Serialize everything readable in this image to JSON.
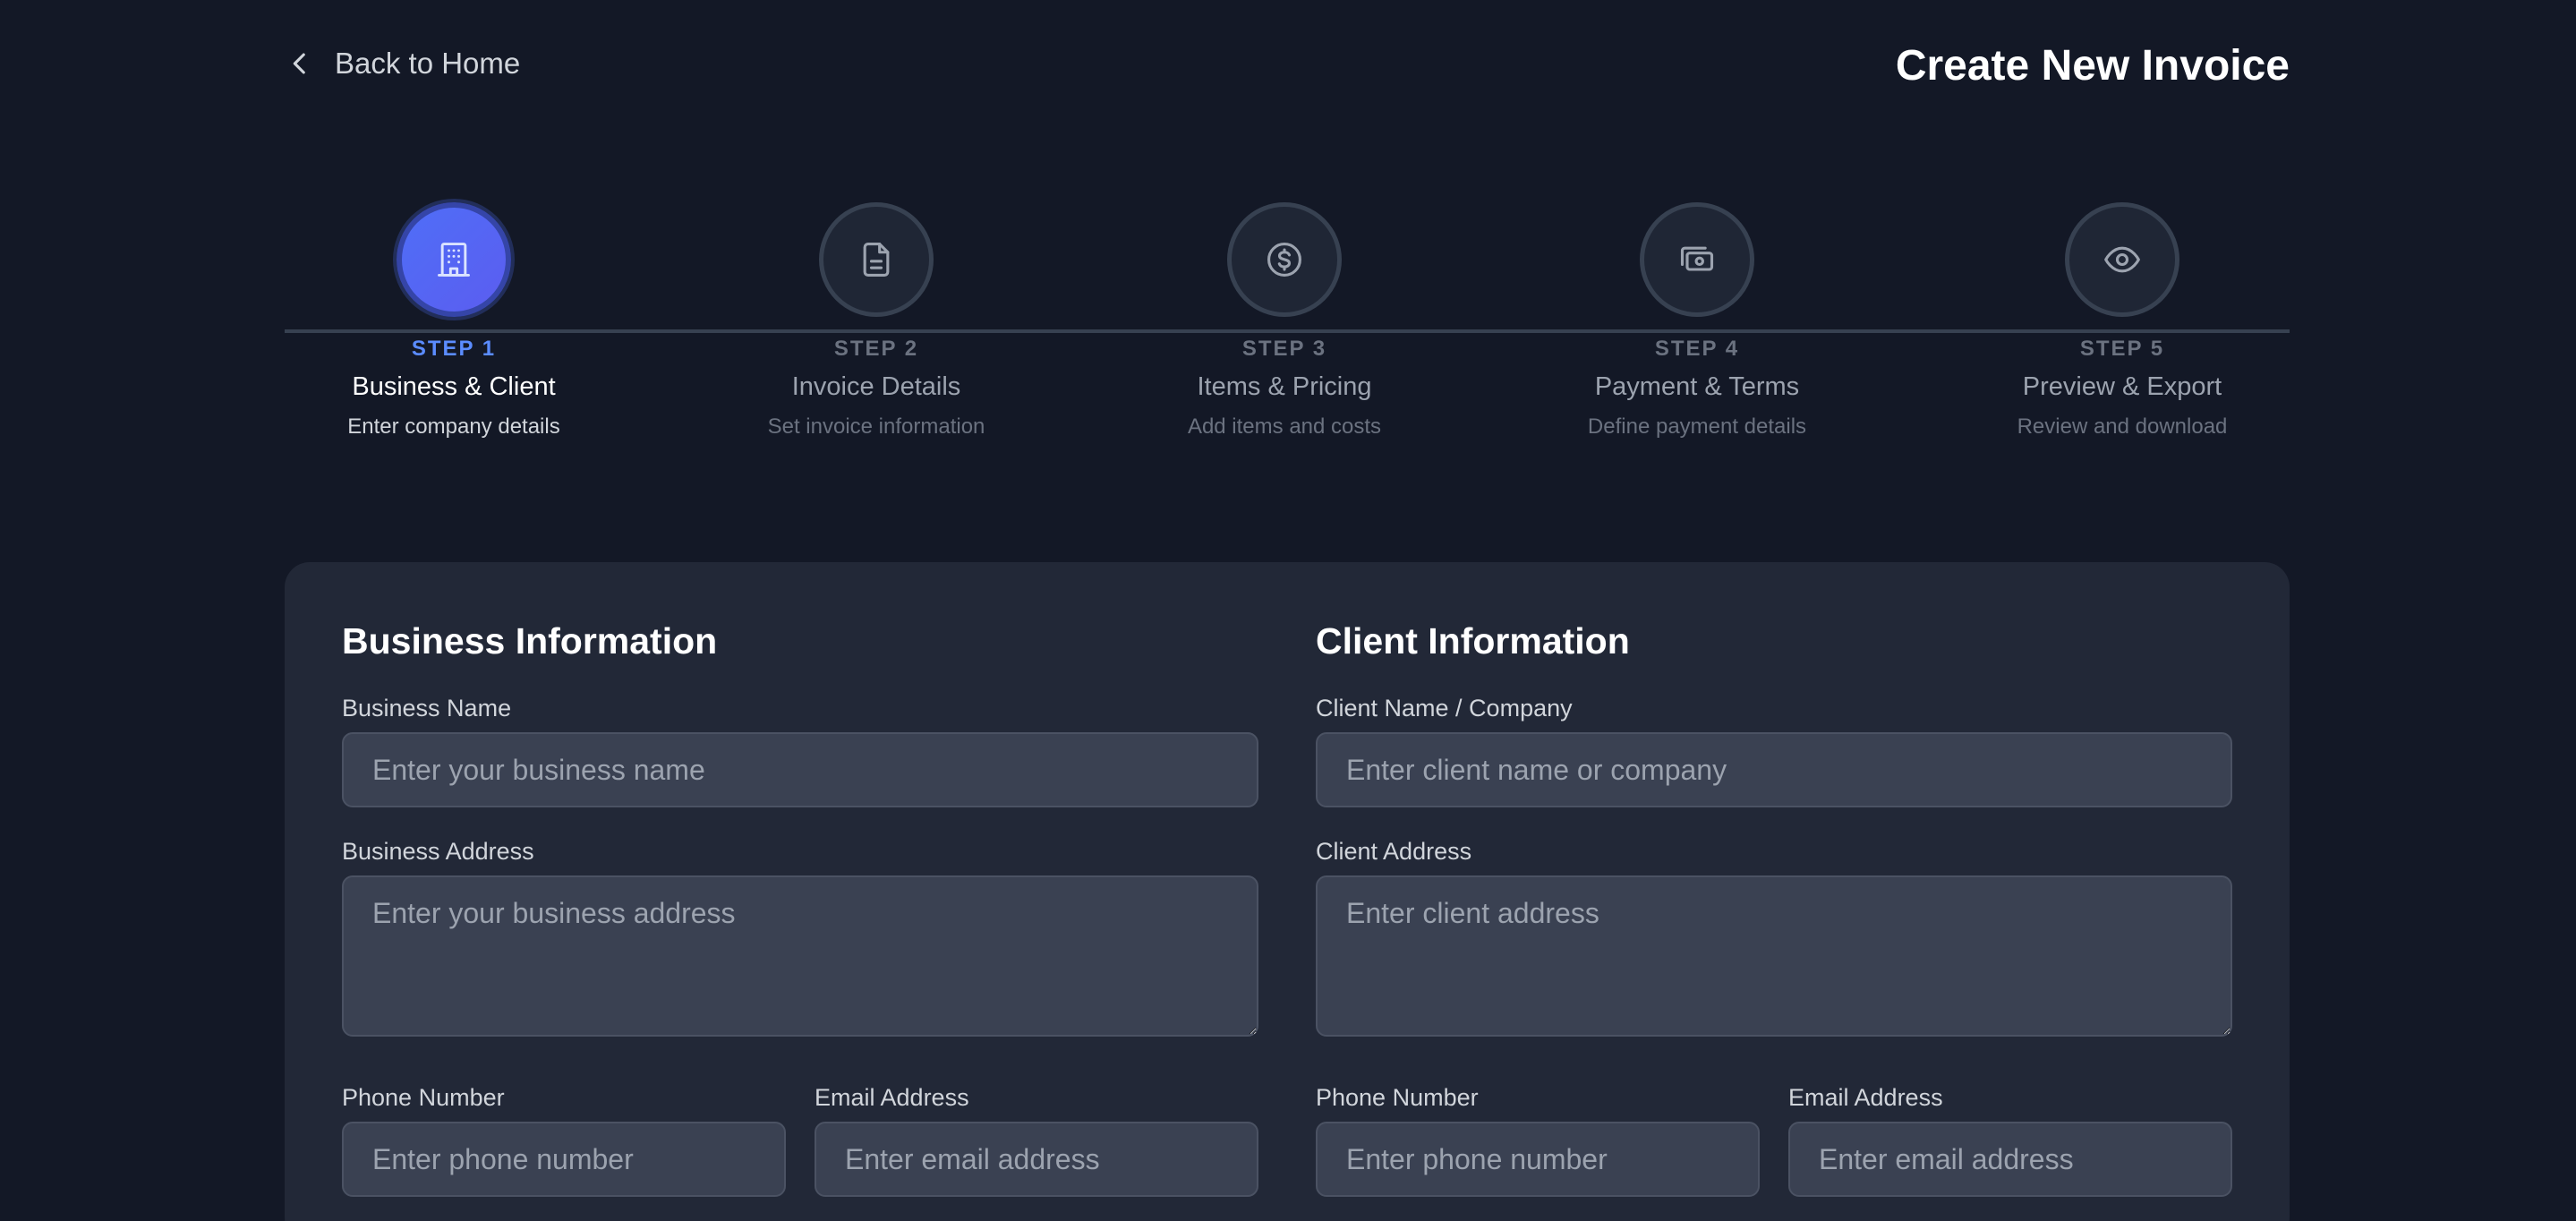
{
  "header": {
    "back_label": "Back to Home",
    "title": "Create New Invoice"
  },
  "stepper": {
    "active_step": 1,
    "steps": [
      {
        "number": "STEP 1",
        "name": "Business & Client",
        "description": "Enter company details",
        "icon": "building-icon"
      },
      {
        "number": "STEP 2",
        "name": "Invoice Details",
        "description": "Set invoice information",
        "icon": "document-icon"
      },
      {
        "number": "STEP 3",
        "name": "Items & Pricing",
        "description": "Add items and costs",
        "icon": "dollar-icon"
      },
      {
        "number": "STEP 4",
        "name": "Payment & Terms",
        "description": "Define payment details",
        "icon": "cash-icon"
      },
      {
        "number": "STEP 5",
        "name": "Preview & Export",
        "description": "Review and download",
        "icon": "eye-icon"
      }
    ]
  },
  "business": {
    "title": "Business Information",
    "name_label": "Business Name",
    "name_placeholder": "Enter your business name",
    "name_value": "",
    "address_label": "Business Address",
    "address_placeholder": "Enter your business address",
    "address_value": "",
    "phone_label": "Phone Number",
    "phone_placeholder": "Enter phone number",
    "phone_value": "",
    "email_label": "Email Address",
    "email_placeholder": "Enter email address",
    "email_value": ""
  },
  "client": {
    "title": "Client Information",
    "name_label": "Client Name / Company",
    "name_placeholder": "Enter client name or company",
    "name_value": "",
    "address_label": "Client Address",
    "address_placeholder": "Enter client address",
    "address_value": "",
    "phone_label": "Phone Number",
    "phone_placeholder": "Enter phone number",
    "phone_value": "",
    "email_label": "Email Address",
    "email_placeholder": "Enter email address",
    "email_value": ""
  },
  "colors": {
    "background": "#131826",
    "card": "#222837",
    "accent": "#4f6ef7",
    "active_step_text": "#5b8cff",
    "input_bg": "#3a4152"
  }
}
